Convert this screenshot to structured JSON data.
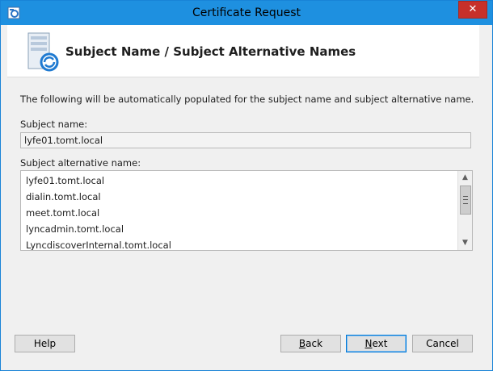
{
  "window": {
    "title": "Certificate Request",
    "close_glyph": "✕"
  },
  "header": {
    "title": "Subject Name / Subject Alternative Names",
    "icon": "server-certificate-icon"
  },
  "body": {
    "intro": "The following will be automatically populated for the subject name and subject alternative name.",
    "subject_name_label": "Subject name:",
    "subject_name_value": "lyfe01.tomt.local",
    "san_label": "Subject alternative name:",
    "san_items": [
      "lyfe01.tomt.local",
      "dialin.tomt.local",
      "meet.tomt.local",
      "lyncadmin.tomt.local",
      "LyncdiscoverInternal.tomt.local"
    ]
  },
  "buttons": {
    "help": "Help",
    "back_prefix": "",
    "back_underline": "B",
    "back_rest": "ack",
    "next_prefix": "",
    "next_underline": "N",
    "next_rest": "ext",
    "cancel": "Cancel"
  },
  "colors": {
    "titlebar": "#1e90e0",
    "close": "#c7302a"
  }
}
